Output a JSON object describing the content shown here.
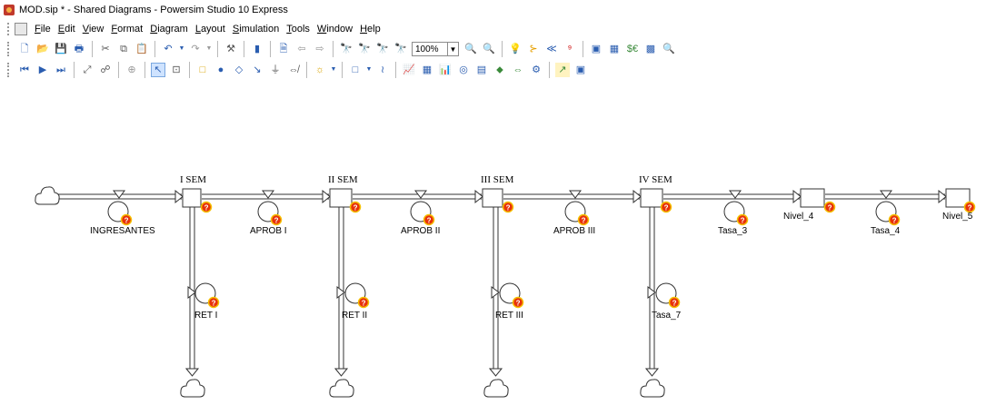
{
  "window": {
    "title": "MOD.sip * - Shared Diagrams - Powersim Studio 10 Express"
  },
  "menu": [
    "File",
    "Edit",
    "View",
    "Format",
    "Diagram",
    "Layout",
    "Simulation",
    "Tools",
    "Window",
    "Help"
  ],
  "toolbar": {
    "zoom_value": "100%"
  },
  "diagram": {
    "stocks": [
      {
        "name": "I SEM"
      },
      {
        "name": "II SEM"
      },
      {
        "name": "III SEM"
      },
      {
        "name": "IV SEM"
      },
      {
        "name": "Nivel_4"
      },
      {
        "name": "Nivel_5"
      }
    ],
    "flows": [
      {
        "name": "INGRESANTES"
      },
      {
        "name": "APROB I"
      },
      {
        "name": "APROB II"
      },
      {
        "name": "APROB III"
      },
      {
        "name": "Tasa_3"
      },
      {
        "name": "Tasa_4"
      },
      {
        "name": "RET I"
      },
      {
        "name": "RET II"
      },
      {
        "name": "RET III"
      },
      {
        "name": "Tasa_7"
      }
    ],
    "warning_symbol": "?",
    "colors": {
      "warning": "#e8320a",
      "warning_ring": "#f5c000",
      "line": "#333333"
    }
  }
}
